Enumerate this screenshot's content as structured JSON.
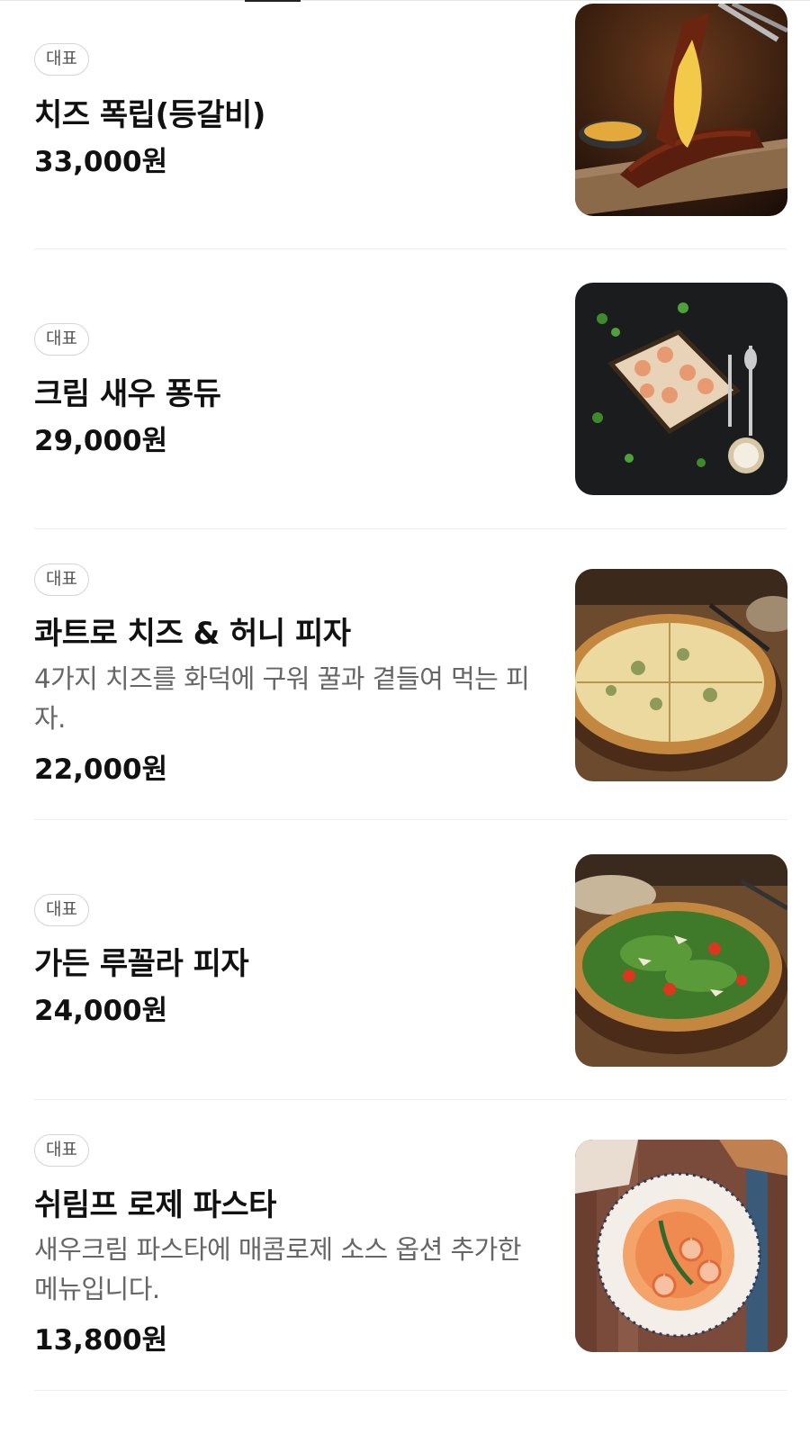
{
  "items": [
    {
      "badge": "대표",
      "name": "치즈 폭립(등갈비)",
      "description": "",
      "price": "33,000원",
      "image_icon": "ribs-photo"
    },
    {
      "badge": "대표",
      "name": "크림 새우 퐁듀",
      "description": "",
      "price": "29,000원",
      "image_icon": "shrimp-fondue-photo"
    },
    {
      "badge": "대표",
      "name": "콰트로 치즈 & 허니 피자",
      "description": "4가지 치즈를 화덕에 구워 꿀과 곁들여 먹는 피자.",
      "price": "22,000원",
      "image_icon": "cheese-pizza-photo"
    },
    {
      "badge": "대표",
      "name": "가든 루꼴라 피자",
      "description": "",
      "price": "24,000원",
      "image_icon": "arugula-pizza-photo"
    },
    {
      "badge": "대표",
      "name": "쉬림프 로제 파스타",
      "description": "새우크림 파스타에 매콤로제 소스 옵션 추가한 메뉴입니다.",
      "price": "13,800원",
      "image_icon": "rose-pasta-photo"
    }
  ]
}
